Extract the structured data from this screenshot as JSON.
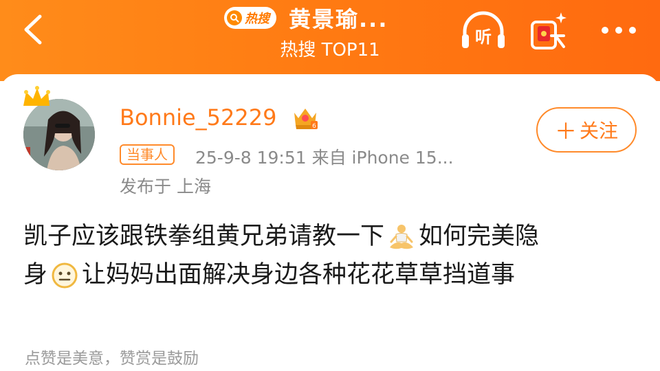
{
  "header": {
    "badge_label": "热搜",
    "title": "黄景瑜...",
    "subtitle": "热搜 TOP11",
    "icons": [
      "back-arrow-icon",
      "search-icon",
      "headphones-listen-icon",
      "red-envelope-icon",
      "more-icon"
    ],
    "listen_label": "听"
  },
  "post": {
    "username": "Bonnie_52229",
    "role_tag": "当事人",
    "meta": "25-9-8 19:51  来自 iPhone 15...",
    "location": "发布于 上海",
    "follow_label": "关注",
    "content_line1_a": "凯子应该跟铁拳组黄兄弟请教一下",
    "content_line1_b": "如何完美隐",
    "content_line2_a": "身",
    "content_line2_b": "让妈妈出面解决身边各种花花草草挡道事",
    "footer": "点赞是美意，赞赏是鼓励"
  },
  "colors": {
    "header_gradient_start": "#ff8c1a",
    "header_gradient_end": "#ff6a10",
    "accent": "#ff7a1a",
    "meta_text": "#8a8a8a"
  }
}
